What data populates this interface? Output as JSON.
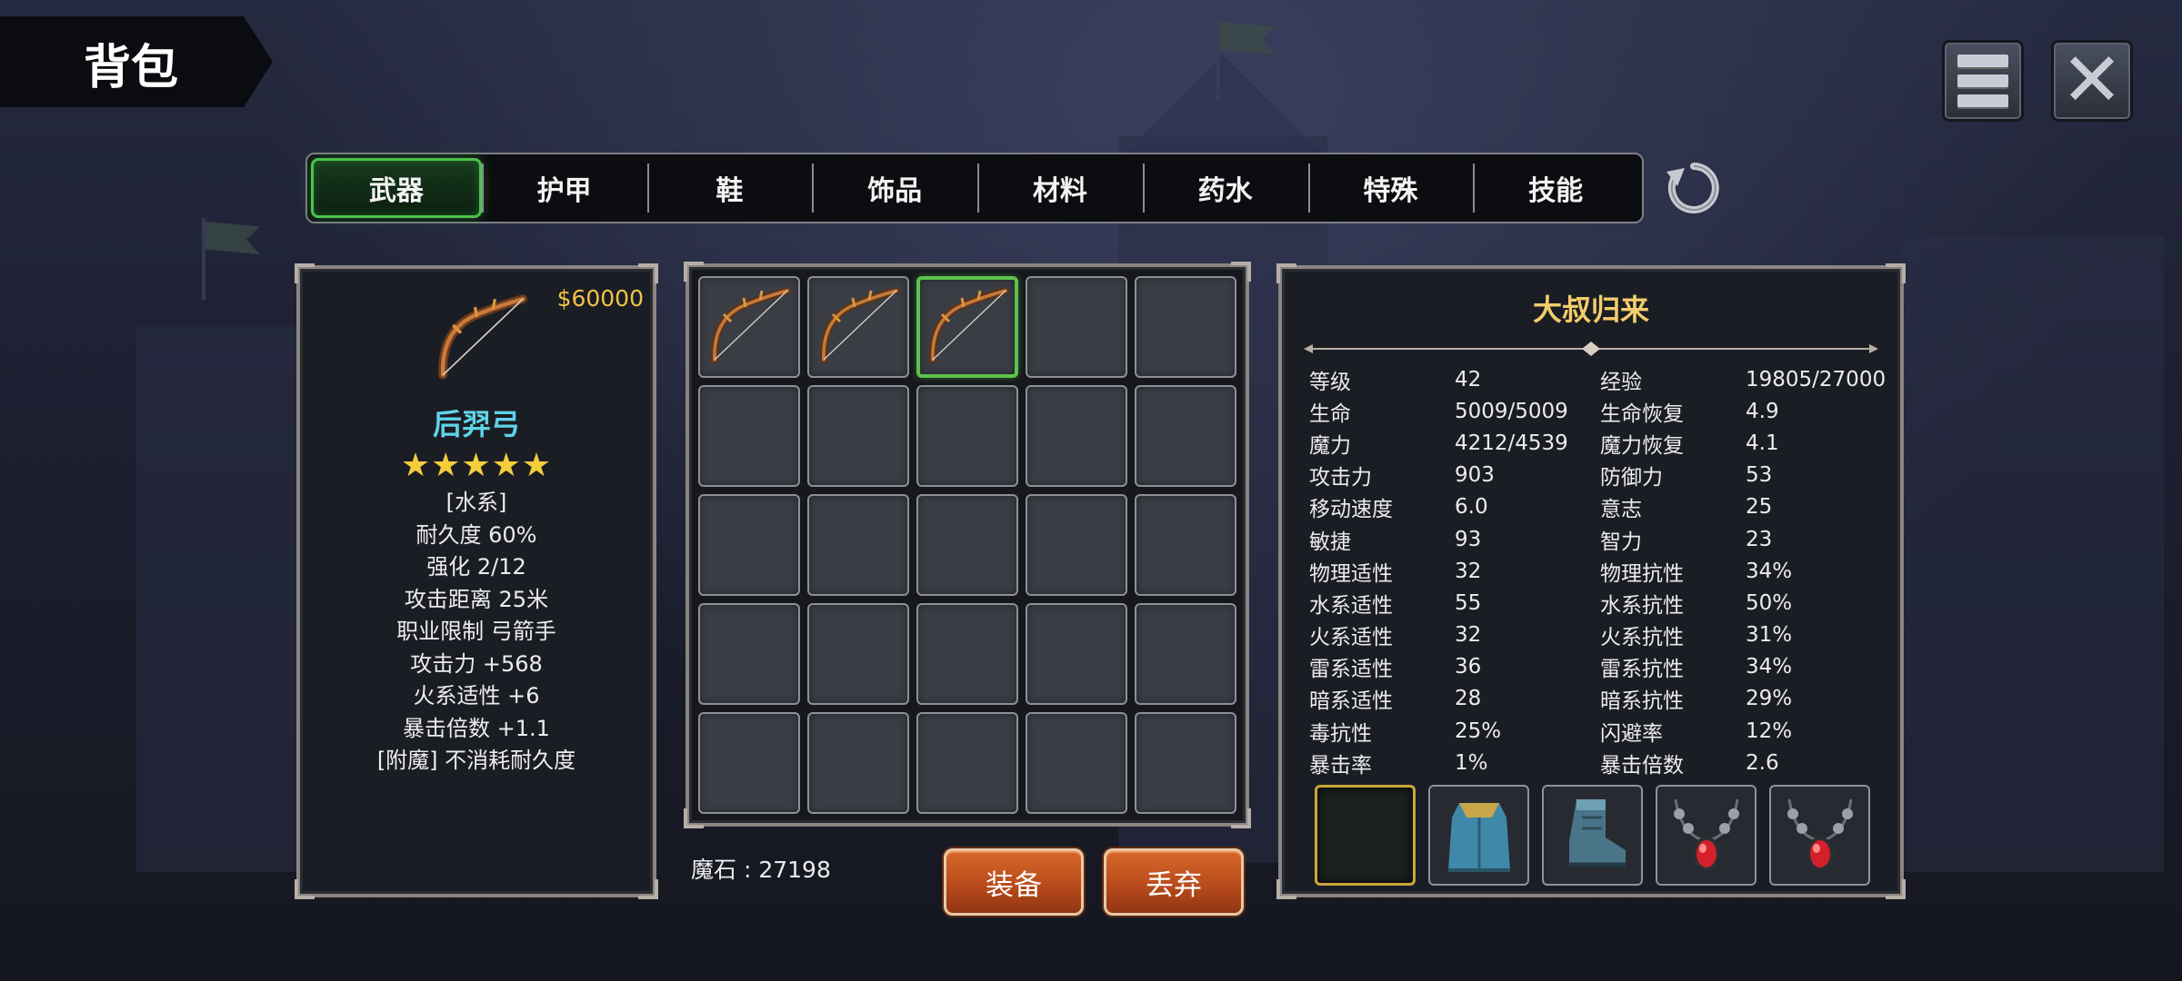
{
  "header": {
    "title": "背包"
  },
  "top_buttons": {
    "menu": "menu-icon",
    "close": "close-icon"
  },
  "tabs": [
    {
      "label": "武器",
      "active": true
    },
    {
      "label": "护甲",
      "active": false
    },
    {
      "label": "鞋",
      "active": false
    },
    {
      "label": "饰品",
      "active": false
    },
    {
      "label": "材料",
      "active": false
    },
    {
      "label": "药水",
      "active": false
    },
    {
      "label": "特殊",
      "active": false
    },
    {
      "label": "技能",
      "active": false
    }
  ],
  "item_detail": {
    "price": "$60000",
    "icon": "bow-icon",
    "name": "后羿弓",
    "stars": "★★★★★",
    "rating": 5,
    "lines": [
      "[水系]",
      "耐久度 60%",
      "强化 2/12",
      "攻击距离  25米",
      "职业限制  弓箭手",
      "攻击力  +568",
      "火系适性  +6",
      "暴击倍数  +1.1",
      "[附魔] 不消耗耐久度"
    ]
  },
  "inventory": {
    "slots": [
      {
        "item": "bow-icon",
        "selected": false
      },
      {
        "item": "bow-icon",
        "selected": false
      },
      {
        "item": "bow-icon",
        "selected": true
      }
    ],
    "total_slots": 25
  },
  "footer": {
    "mana_stone": "魔石 : 27198",
    "equip_label": "装备",
    "discard_label": "丢弃"
  },
  "character": {
    "name": "大叔归来",
    "stats": [
      [
        "等级",
        "42",
        "经验",
        "19805/27000"
      ],
      [
        "生命",
        "5009/5009",
        "生命恢复",
        "4.9"
      ],
      [
        "魔力",
        "4212/4539",
        "魔力恢复",
        "4.1"
      ],
      [
        "攻击力",
        "903",
        "防御力",
        "53"
      ],
      [
        "移动速度",
        "6.0",
        "意志",
        "25"
      ],
      [
        "敏捷",
        "93",
        "智力",
        "23"
      ],
      [
        "物理适性",
        "32",
        "物理抗性",
        "34%"
      ],
      [
        "水系适性",
        "55",
        "水系抗性",
        "50%"
      ],
      [
        "火系适性",
        "32",
        "火系抗性",
        "31%"
      ],
      [
        "雷系适性",
        "36",
        "雷系抗性",
        "34%"
      ],
      [
        "暗系适性",
        "28",
        "暗系抗性",
        "29%"
      ],
      [
        "毒抗性",
        "25%",
        "闪避率",
        "12%"
      ],
      [
        "暴击率",
        "1%",
        "暴击倍数",
        "2.6"
      ]
    ],
    "equipment": [
      "empty-slot",
      "cloak-icon",
      "boot-icon",
      "necklace-icon",
      "necklace-icon"
    ]
  },
  "colors": {
    "accent_green": "#4cc24b",
    "price_gold": "#f1c347",
    "item_name_cyan": "#5fd3e8",
    "button_orange": "#c1521e"
  }
}
